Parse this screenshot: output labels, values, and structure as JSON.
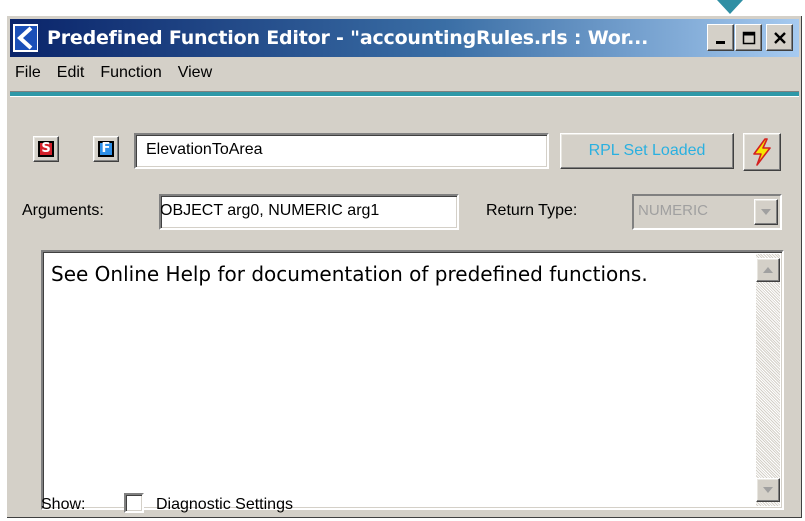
{
  "window": {
    "title": "Predefined Function Editor - \"accountingRules.rls : Wor...",
    "controls": {
      "minimize_icon": "minimize-icon",
      "maximize_icon": "maximize-icon",
      "close_icon": "close-icon"
    }
  },
  "menu": {
    "items": [
      {
        "label": "File"
      },
      {
        "label": "Edit"
      },
      {
        "label": "Function"
      },
      {
        "label": "View"
      }
    ]
  },
  "toolbar": {
    "s_button": "S",
    "f_button": "F",
    "function_name": "ElevationToArea",
    "rpl_status": "RPL Set Loaded",
    "bolt_icon": "lightning-bolt-icon"
  },
  "signature": {
    "arguments_label": "Arguments:",
    "arguments_value": "OBJECT arg0, NUMERIC arg1",
    "return_type_label": "Return Type:",
    "return_type_value": "NUMERIC"
  },
  "description": {
    "text": "See Online Help for documentation of predefined functions."
  },
  "footer": {
    "show_label": "Show:",
    "diagnostic_label": "Diagnostic Settings",
    "diagnostic_checked": false
  },
  "colors": {
    "title_gradient_start": "#0a246a",
    "title_gradient_end": "#a6caf0",
    "accent_teal": "#2e98a8",
    "rpl_text": "#2ab0e0",
    "s_button": "#d4202a",
    "f_button": "#2e90e8",
    "bolt": "#f5e600"
  }
}
